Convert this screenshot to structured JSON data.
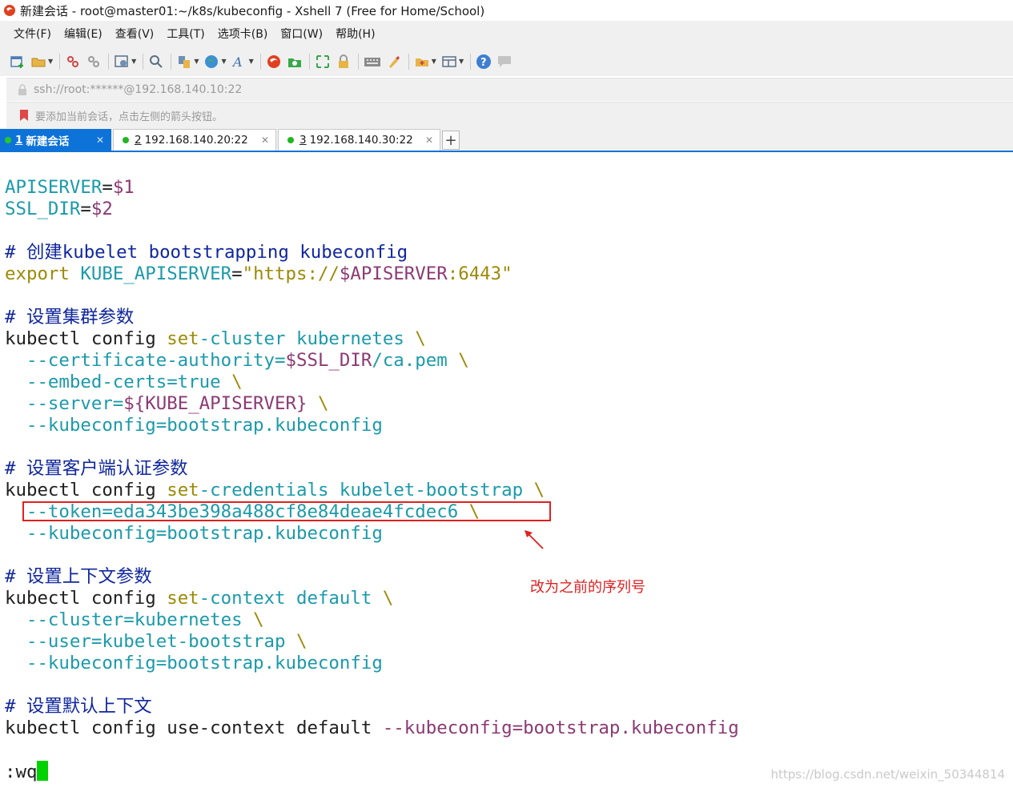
{
  "window": {
    "title": "新建会话 - root@master01:~/k8s/kubeconfig - Xshell 7 (Free for Home/School)"
  },
  "menu": {
    "items": [
      "文件(F)",
      "编辑(E)",
      "查看(V)",
      "工具(T)",
      "选项卡(B)",
      "窗口(W)",
      "帮助(H)"
    ]
  },
  "toolbar": {
    "icons": [
      "new-session-icon",
      "open-folder-icon",
      "reconnect-icon",
      "disconnect-icon",
      "properties-icon",
      "find-icon",
      "copy-paste-icon",
      "globe-icon",
      "font-icon",
      "xshell-icon",
      "xftp-icon",
      "fullscreen-icon",
      "lock-icon",
      "keyboard-icon",
      "highlight-icon",
      "new-folder-icon",
      "layout-icon",
      "help-icon",
      "chat-icon"
    ]
  },
  "address": {
    "value": "ssh://root:******@192.168.140.10:22"
  },
  "hint": {
    "text": "要添加当前会话，点击左侧的箭头按钮。"
  },
  "tabs": [
    {
      "num": "1",
      "label": "新建会话",
      "active": true
    },
    {
      "num": "2",
      "label": "192.168.140.20:22",
      "active": false
    },
    {
      "num": "3",
      "label": "192.168.140.30:22",
      "active": false
    }
  ],
  "tab_add_label": "+",
  "terminal": {
    "lines": [
      {
        "segments": [
          {
            "t": "APISERVER",
            "c": "teal"
          },
          {
            "t": "=",
            "c": "plain"
          },
          {
            "t": "$1",
            "c": "purple"
          }
        ]
      },
      {
        "segments": [
          {
            "t": "SSL_DIR",
            "c": "teal"
          },
          {
            "t": "=",
            "c": "plain"
          },
          {
            "t": "$2",
            "c": "purple"
          }
        ]
      },
      {
        "segments": []
      },
      {
        "segments": [
          {
            "t": "# 创建kubelet bootstrapping kubeconfig",
            "c": "navy"
          }
        ]
      },
      {
        "segments": [
          {
            "t": "export ",
            "c": "olive"
          },
          {
            "t": "KUBE_APISERVER",
            "c": "teal"
          },
          {
            "t": "=",
            "c": "plain"
          },
          {
            "t": "\"https://",
            "c": "olive"
          },
          {
            "t": "$APISERVER",
            "c": "purple"
          },
          {
            "t": ":6443\"",
            "c": "olive"
          }
        ]
      },
      {
        "segments": []
      },
      {
        "segments": [
          {
            "t": "# 设置集群参数",
            "c": "navy"
          }
        ]
      },
      {
        "segments": [
          {
            "t": "kubectl config ",
            "c": "plain"
          },
          {
            "t": "set",
            "c": "olive"
          },
          {
            "t": "-cluster kubernetes ",
            "c": "teal"
          },
          {
            "t": "\\",
            "c": "olive"
          }
        ]
      },
      {
        "segments": [
          {
            "t": "  --certificate-authority=",
            "c": "teal"
          },
          {
            "t": "$SSL_DIR",
            "c": "purple"
          },
          {
            "t": "/ca.pem ",
            "c": "teal"
          },
          {
            "t": "\\",
            "c": "olive"
          }
        ]
      },
      {
        "segments": [
          {
            "t": "  --embed-certs=true ",
            "c": "teal"
          },
          {
            "t": "\\",
            "c": "olive"
          }
        ]
      },
      {
        "segments": [
          {
            "t": "  --server=",
            "c": "teal"
          },
          {
            "t": "${KUBE_APISERVER}",
            "c": "purple"
          },
          {
            "t": " ",
            "c": "plain"
          },
          {
            "t": "\\",
            "c": "olive"
          }
        ]
      },
      {
        "segments": [
          {
            "t": "  --kubeconfig=bootstrap.kubeconfig",
            "c": "teal"
          }
        ]
      },
      {
        "segments": []
      },
      {
        "segments": [
          {
            "t": "# 设置客户端认证参数",
            "c": "navy"
          }
        ]
      },
      {
        "segments": [
          {
            "t": "kubectl config ",
            "c": "plain"
          },
          {
            "t": "set",
            "c": "olive"
          },
          {
            "t": "-credentials kubelet-bootstrap ",
            "c": "teal"
          },
          {
            "t": "\\",
            "c": "olive"
          }
        ]
      },
      {
        "segments": [
          {
            "t": "  --token=eda343be398a488cf8e84deae4fcdec6 ",
            "c": "teal"
          },
          {
            "t": "\\",
            "c": "olive"
          }
        ]
      },
      {
        "segments": [
          {
            "t": "  --kubeconfig=bootstrap.kubeconfig",
            "c": "teal"
          }
        ]
      },
      {
        "segments": []
      },
      {
        "segments": [
          {
            "t": "# 设置上下文参数",
            "c": "navy"
          }
        ]
      },
      {
        "segments": [
          {
            "t": "kubectl config ",
            "c": "plain"
          },
          {
            "t": "set",
            "c": "olive"
          },
          {
            "t": "-context default ",
            "c": "teal"
          },
          {
            "t": "\\",
            "c": "olive"
          }
        ]
      },
      {
        "segments": [
          {
            "t": "  --cluster=kubernetes ",
            "c": "teal"
          },
          {
            "t": "\\",
            "c": "olive"
          }
        ]
      },
      {
        "segments": [
          {
            "t": "  --user=kubelet-bootstrap ",
            "c": "teal"
          },
          {
            "t": "\\",
            "c": "olive"
          }
        ]
      },
      {
        "segments": [
          {
            "t": "  --kubeconfig=bootstrap.kubeconfig",
            "c": "teal"
          }
        ]
      },
      {
        "segments": []
      },
      {
        "segments": [
          {
            "t": "# 设置默认上下文",
            "c": "navy"
          }
        ]
      },
      {
        "segments": [
          {
            "t": "kubectl config use-context default ",
            "c": "plain"
          },
          {
            "t": "--",
            "c": "purple"
          },
          {
            "t": "kubeconfig=bootstrap.kubeconfig",
            "c": "purple"
          }
        ]
      },
      {
        "segments": []
      },
      {
        "segments": [
          {
            "t": ":wq",
            "c": "plain"
          }
        ],
        "cursor": true
      }
    ],
    "colors": {
      "teal": "#1b9aaa",
      "purple": "#8c3a73",
      "olive": "#9c8a08",
      "navy": "#10279e",
      "plain": "#1f1f1f",
      "cursor": "#00d100"
    }
  },
  "annotation": {
    "text": "改为之前的序列号",
    "color": "#e02020"
  },
  "watermark": "https://blog.csdn.net/weixin_50344814"
}
